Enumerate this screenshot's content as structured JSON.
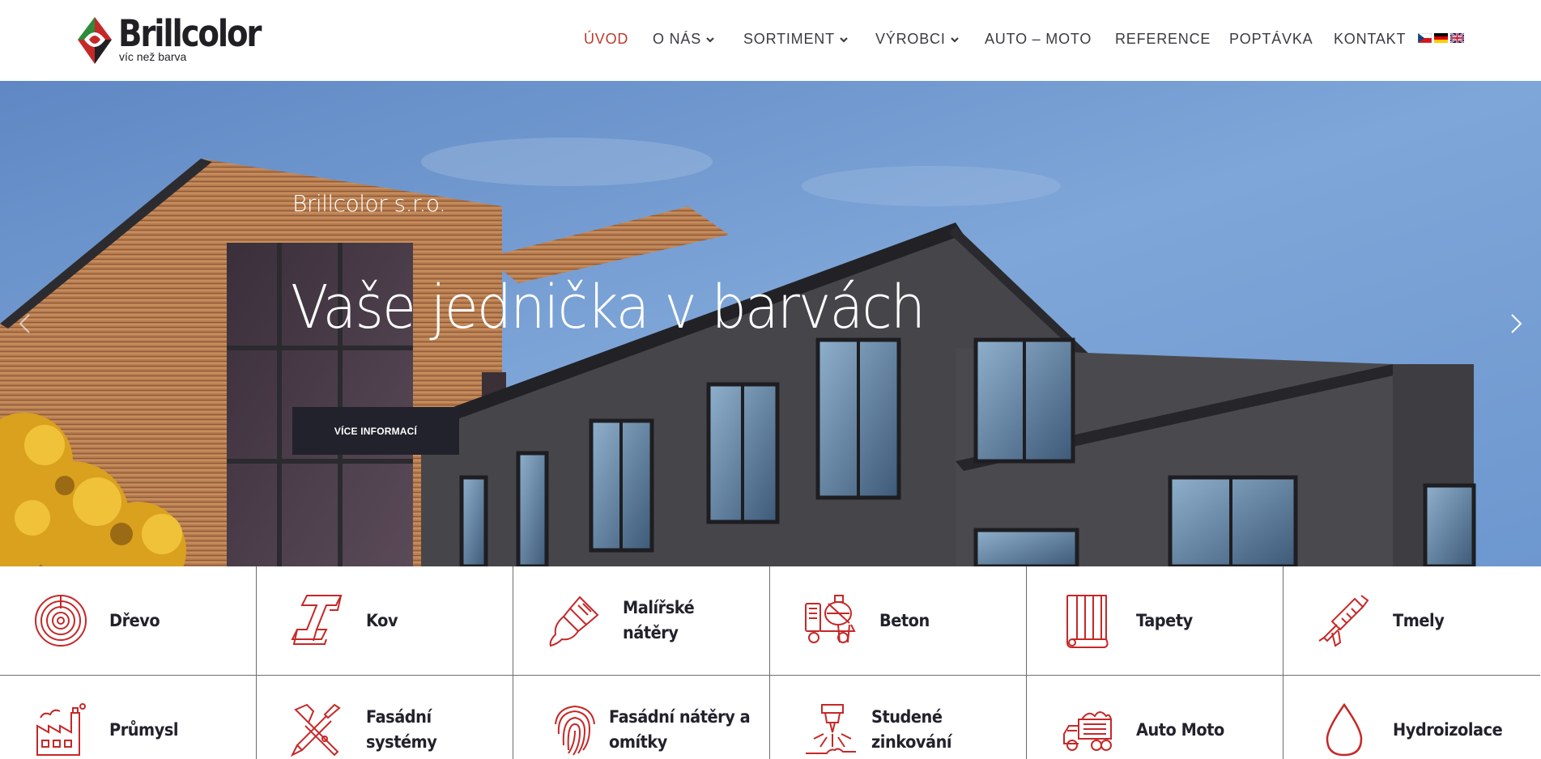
{
  "header": {
    "logo": {
      "name": "Brillcolor",
      "tagline": "víc než barva"
    },
    "nav": [
      {
        "label": "ÚVOD",
        "active": true,
        "dropdown": false
      },
      {
        "label": "O NÁS",
        "active": false,
        "dropdown": true
      },
      {
        "label": "SORTIMENT",
        "active": false,
        "dropdown": true
      },
      {
        "label": "VÝROBCI",
        "active": false,
        "dropdown": true
      },
      {
        "label": "AUTO – MOTO",
        "active": false,
        "dropdown": false
      },
      {
        "label": "REFERENCE",
        "active": false,
        "dropdown": false
      },
      {
        "label": "POPTÁVKA",
        "active": false,
        "dropdown": false
      },
      {
        "label": "KONTAKT",
        "active": false,
        "dropdown": false
      }
    ],
    "languages": [
      "cs-flag-icon",
      "de-flag-icon",
      "en-flag-icon"
    ]
  },
  "hero": {
    "kicker": "Brillcolor s.r.o.",
    "title": "Vaše jednička v barvách",
    "button": "VÍCE INFORMACÍ"
  },
  "categories": [
    {
      "label": "Dřevo",
      "icon": "wood-rings-icon"
    },
    {
      "label": "Kov",
      "icon": "steel-beam-icon"
    },
    {
      "label": "Malířské nátěry",
      "icon": "paint-brush-icon"
    },
    {
      "label": "Beton",
      "icon": "concrete-mixer-icon"
    },
    {
      "label": "Tapety",
      "icon": "wallpaper-roll-icon"
    },
    {
      "label": "Tmely",
      "icon": "caulk-gun-icon"
    },
    {
      "label": "Průmysl",
      "icon": "factory-icon"
    },
    {
      "label": "Fasádní systémy",
      "icon": "trowel-tools-icon"
    },
    {
      "label": "Fasádní nátěry a omítky",
      "icon": "fingerprint-icon"
    },
    {
      "label": "Studené zinkování",
      "icon": "spray-nozzle-icon"
    },
    {
      "label": "Auto Moto",
      "icon": "truck-icon"
    },
    {
      "label": "Hydroizolace",
      "icon": "water-drop-icon"
    }
  ],
  "colors": {
    "accent": "#c0392b",
    "dark": "#22222c",
    "icon": "#c62828"
  }
}
